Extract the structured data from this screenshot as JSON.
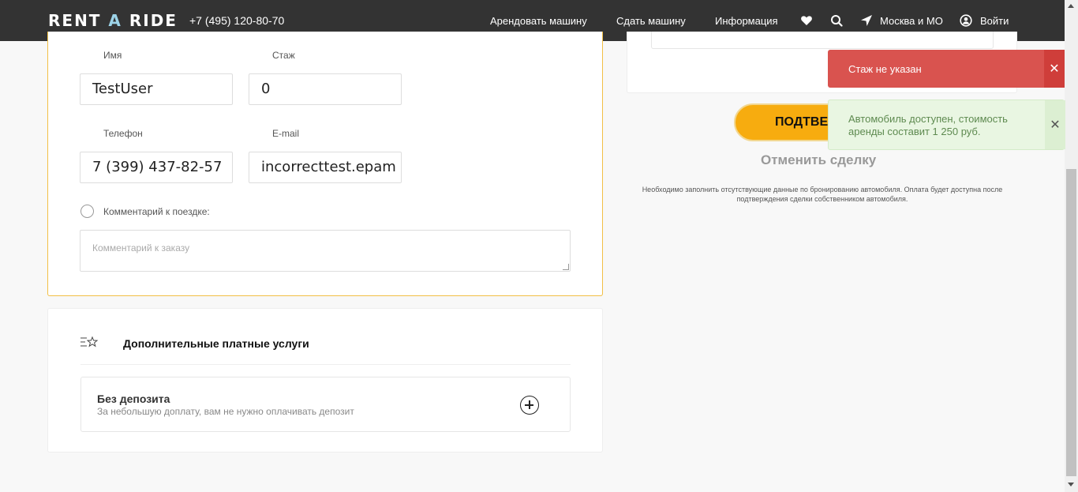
{
  "header": {
    "logo_left": "RENT ",
    "logo_accent": "A",
    "logo_right": " RIDE",
    "phone": "+7 (495) 120-80-70",
    "nav": [
      "Арендовать машину",
      "Сдать машину",
      "Информация"
    ],
    "location": "Москва и МО",
    "login": "Войти"
  },
  "form": {
    "name_label": "Имя",
    "name_value": "TestUser",
    "experience_label": "Стаж",
    "experience_value": "0",
    "phone_label": "Телефон",
    "phone_value": "7 (399) 437-82-57",
    "email_label": "E-mail",
    "email_value": "incorrecttest.epam",
    "comment_toggle_label": "Комментарий к поездке:",
    "comment_placeholder": "Комментарий к заказу"
  },
  "services": {
    "title": "Дополнительные платные услуги",
    "items": [
      {
        "name": "Без депозита",
        "description": "За небольшую доплату, вам не нужно оплачивать депозит"
      }
    ]
  },
  "booking": {
    "confirm_label": "ПОДТВЕРДИТЬ",
    "cancel_label": "Отменить сделку",
    "notice": "Необходимо заполнить отсутствующие данные по бронированию автомобиля. Оплата будет доступна после подтверждения сделки собственником автомобиля."
  },
  "toasts": {
    "error": "Стаж не указан",
    "success": "Автомобиль доступен, стоимость аренды составит 1 250 руб.",
    "close_glyph": "✕"
  },
  "colors": {
    "header_bg": "#333333",
    "accent_yellow": "#f7ac0f",
    "error_red": "#d9534f",
    "success_green_bg": "#e9f6e2"
  }
}
